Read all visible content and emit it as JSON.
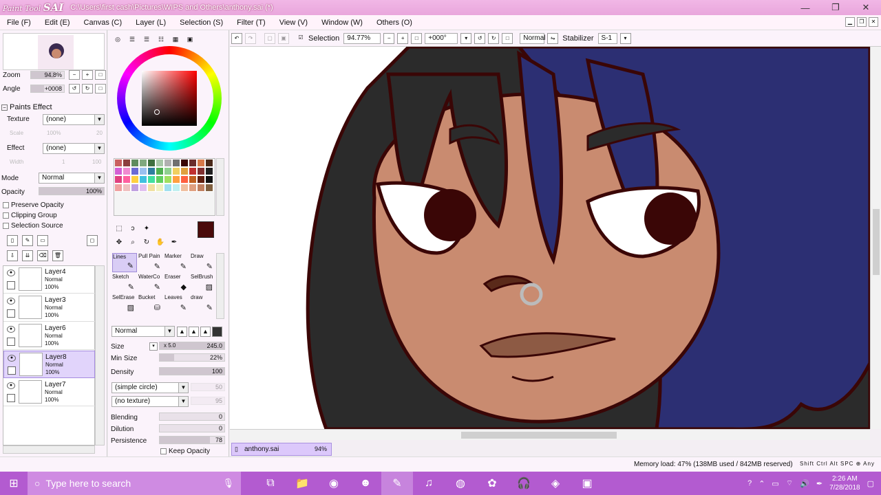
{
  "titlebar": {
    "app_name_small": "Paint Tool",
    "app_name_big": "SAI",
    "file_path": "C:\\Users\\first cash\\Pictures\\WIPS and Others\\anthony.sai (*)",
    "minimize": "—",
    "maximize": "❐",
    "close": "✕"
  },
  "menubar": {
    "items": [
      "File (F)",
      "Edit (E)",
      "Canvas (C)",
      "Layer (L)",
      "Selection (S)",
      "Filter (T)",
      "View (V)",
      "Window (W)",
      "Others (O)"
    ]
  },
  "navigator": {
    "zoom_label": "Zoom",
    "zoom_value": "94.8%",
    "angle_label": "Angle",
    "angle_value": "+0008"
  },
  "paints_effect": {
    "header": "Paints Effect",
    "texture_label": "Texture",
    "texture_value": "(none)",
    "scale_label": "Scale",
    "scale_value": "100%",
    "scale_value2": "20",
    "effect_label": "Effect",
    "effect_value": "(none)",
    "width_label": "Width",
    "width_value": "1",
    "width_value2": "100"
  },
  "layer_props": {
    "mode_label": "Mode",
    "mode_value": "Normal",
    "opacity_label": "Opacity",
    "opacity_value": "100%",
    "preserve_opacity": "Preserve Opacity",
    "clipping_group": "Clipping Group",
    "selection_source": "Selection Source"
  },
  "layers": [
    {
      "name": "Layer4",
      "mode": "Normal",
      "opacity": "100%",
      "selected": false
    },
    {
      "name": "Layer3",
      "mode": "Normal",
      "opacity": "100%",
      "selected": false
    },
    {
      "name": "Layer6",
      "mode": "Normal",
      "opacity": "100%",
      "selected": false
    },
    {
      "name": "Layer8",
      "mode": "Normal",
      "opacity": "100%",
      "selected": true
    },
    {
      "name": "Layer7",
      "mode": "Normal",
      "opacity": "100%",
      "selected": false
    }
  ],
  "brushes": [
    {
      "label": "Lines",
      "selected": true
    },
    {
      "label": "Pull Pain",
      "selected": false
    },
    {
      "label": "Marker",
      "selected": false
    },
    {
      "label": "Draw",
      "selected": false
    },
    {
      "label": "Sketch",
      "selected": false
    },
    {
      "label": "WaterCo",
      "selected": false
    },
    {
      "label": "Eraser",
      "selected": false
    },
    {
      "label": "SelBrush",
      "selected": false
    },
    {
      "label": "SelErase",
      "selected": false
    },
    {
      "label": "Bucket",
      "selected": false
    },
    {
      "label": "Leaves",
      "selected": false
    },
    {
      "label": "draw",
      "selected": false
    }
  ],
  "brush_props": {
    "blend_mode": "Normal",
    "size_label": "Size",
    "size_multiplier": "x 5.0",
    "size_value": "245.0",
    "min_size_label": "Min Size",
    "min_size_value": "22%",
    "min_size_fraction": 0.22,
    "density_label": "Density",
    "density_value": "100",
    "shape_value": "(simple circle)",
    "shape_strength": "50",
    "texture_value": "(no texture)",
    "texture_strength": "95",
    "blending_label": "Blending",
    "blending_value": "0",
    "dilution_label": "Dilution",
    "dilution_value": "0",
    "persistence_label": "Persistence",
    "persistence_value": "78",
    "keep_opacity_label": "Keep Opacity"
  },
  "canvas_toolbar": {
    "selection_label": "Selection",
    "zoom_value": "94.77%",
    "angle_value": "+000°",
    "blend_mode": "Normal",
    "stabilizer_label": "Stabilizer",
    "stabilizer_value": "S-1"
  },
  "file_tab": {
    "name": "anthony.sai",
    "zoom": "94%"
  },
  "statusbar": {
    "memory": "Memory load: 47% (138MB used / 842MB reserved)",
    "keys": "Shift Ctrl Alt SPC ⊕ Any"
  },
  "taskbar": {
    "search_placeholder": "Type here to search",
    "time": "2:26 AM",
    "date": "7/28/2018"
  },
  "colors": {
    "title_pink": "#e9a6dc",
    "taskbar_purple": "#b35bd0",
    "foreground_color": "#4a0a0a",
    "hair_blue": "#2c2f73",
    "hair_dark": "#2b2b2b",
    "skin": "#c98b70",
    "outline": "#3a0606"
  }
}
